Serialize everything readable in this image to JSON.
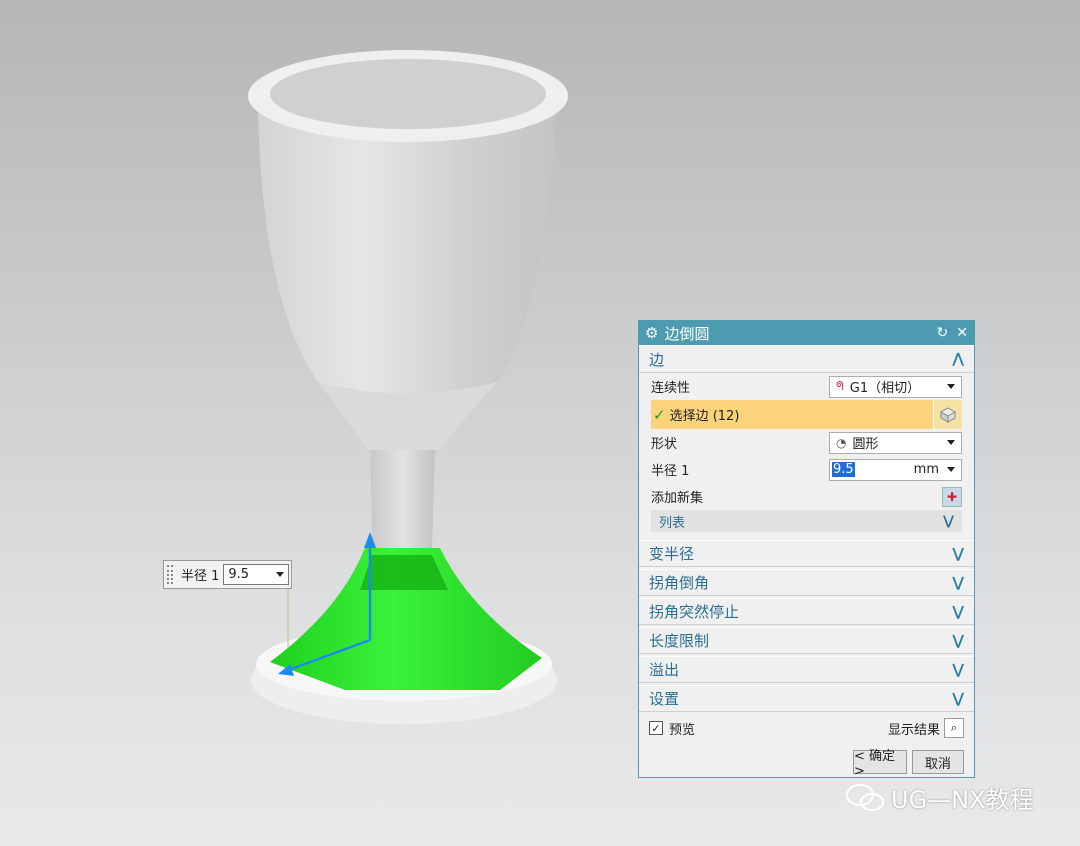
{
  "dynamic_input": {
    "label": "半径 1",
    "value": "9.5"
  },
  "dialog": {
    "title": "边倒圆",
    "sections": {
      "edge": {
        "label": "边",
        "continuity_label": "连续性",
        "continuity_value": "G1（相切）",
        "select_label": "选择边 (12)",
        "shape_label": "形状",
        "shape_value": "圆形",
        "radius_label": "半径 1",
        "radius_value": "9.5",
        "radius_unit": "mm",
        "add_set_label": "添加新集",
        "list_label": "列表"
      },
      "collapsed": [
        "变半径",
        "拐角倒角",
        "拐角突然停止",
        "长度限制",
        "溢出",
        "设置"
      ]
    },
    "preview_label": "预览",
    "show_result_label": "显示结果",
    "ok_label": "< 确定 >",
    "cancel_label": "取消"
  },
  "watermark": "UG—NX教程",
  "colors": {
    "accent": "#4d9bb0",
    "selection": "#fbd37a",
    "highlight_green": "#2ee02e"
  }
}
